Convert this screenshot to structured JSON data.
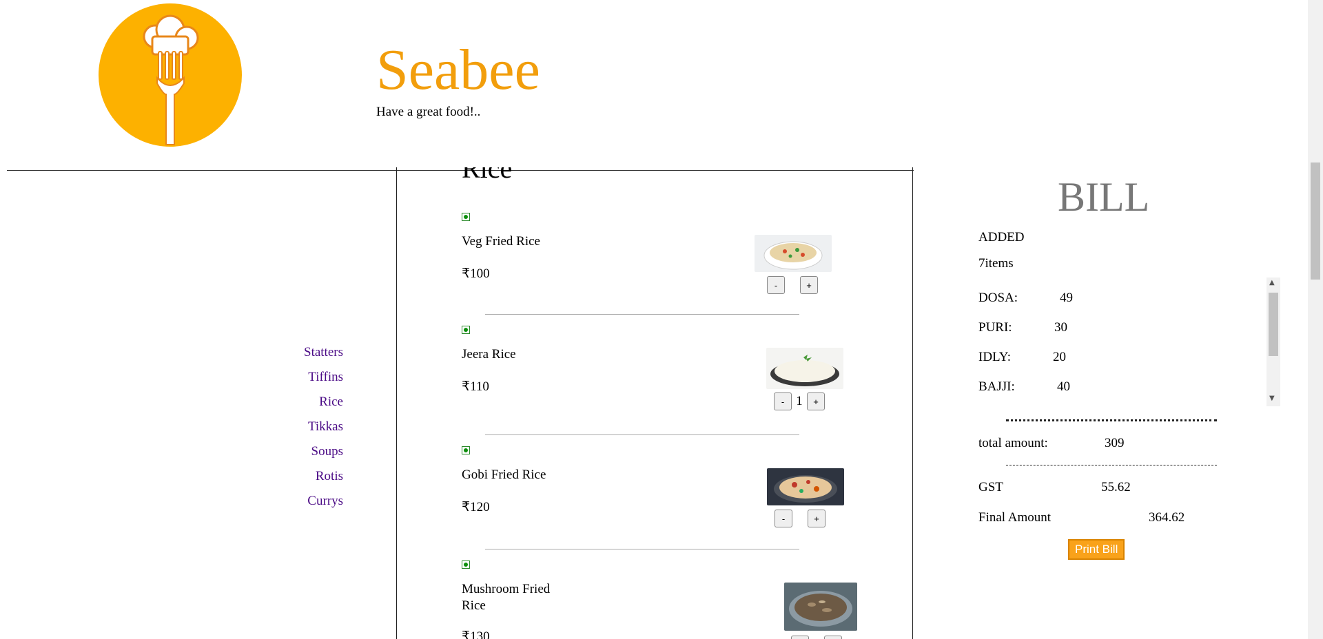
{
  "header": {
    "brand_name": "Seabee",
    "tagline": "Have a great food!..",
    "logo_icon": "chef-hat-fork-icon"
  },
  "nav": {
    "items": [
      {
        "label": "Statters"
      },
      {
        "label": "Tiffins"
      },
      {
        "label": "Rice"
      },
      {
        "label": "Tikkas"
      },
      {
        "label": "Soups"
      },
      {
        "label": "Rotis"
      },
      {
        "label": "Currys"
      }
    ]
  },
  "menu": {
    "section_title": "Rice",
    "items": [
      {
        "name": "Veg Fried Rice",
        "price": "₹100",
        "qty": ""
      },
      {
        "name": "Jeera Rice",
        "price": "₹110",
        "qty": "1"
      },
      {
        "name": "Gobi Fried Rice",
        "price": "₹120",
        "qty": ""
      },
      {
        "name": "Mushroom Fried Rice",
        "price": "₹130",
        "qty": ""
      }
    ],
    "minus_label": "-",
    "plus_label": "+"
  },
  "bill": {
    "title": "BILL",
    "added_label": "ADDED",
    "items_count": "7items",
    "lines": [
      {
        "name": "DOSA:",
        "amount": "49"
      },
      {
        "name": "PURI:",
        "amount": "30"
      },
      {
        "name": "IDLY:",
        "amount": "20"
      },
      {
        "name": "BAJJI:",
        "amount": "40"
      }
    ],
    "total_label": "total amount:",
    "total_value": "309",
    "gst_label": "GST",
    "gst_value": "55.62",
    "final_label": "Final Amount",
    "final_value": "364.62",
    "print_label": "Print Bill"
  },
  "colors": {
    "brand": "#F29E0C",
    "logo_bg": "#FDB100",
    "nav_link": "#4B0B86",
    "print_button": "#F9A21A"
  }
}
